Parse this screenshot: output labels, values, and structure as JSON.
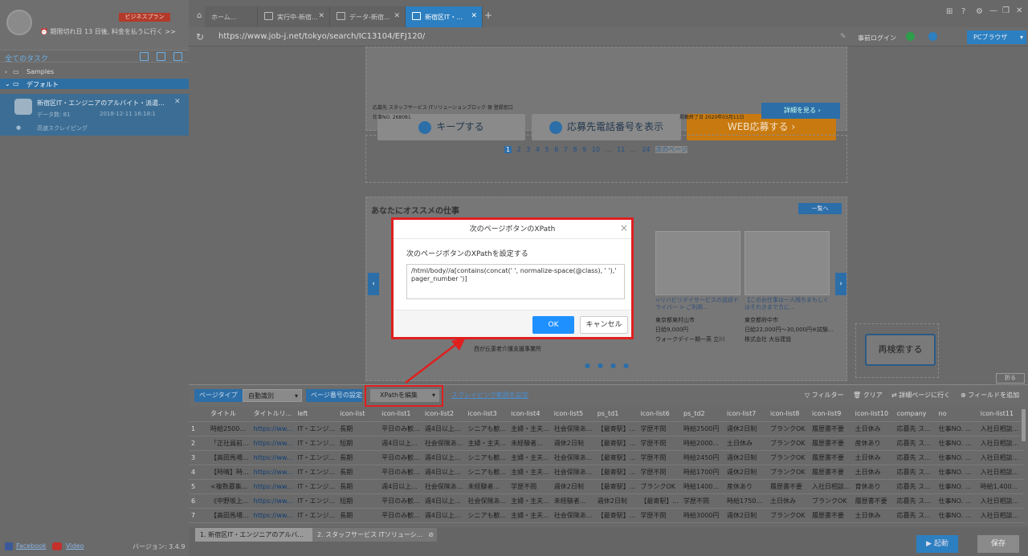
{
  "sidebar": {
    "plan_badge": "ビジネスプラン",
    "expiry": "期限切れ日 13 日後, 料金を払うに行く >>",
    "tasks_header": "全てのタスク",
    "samples": "Samples",
    "default_folder": "デフォルト",
    "task_name": "新宿区IT・エンジニアのアルバイト・派遣...",
    "task_data": "データ数: 81",
    "task_date": "2018-12-11 16:18:1",
    "task_mode": "高速スクレイピング",
    "facebook": "Facebook",
    "video": "Video",
    "version": "バージョン: 3.4.9"
  },
  "tabs": [
    {
      "label": "ホーム...",
      "close": ""
    },
    {
      "label": "実行中-新宿...",
      "close": "✕"
    },
    {
      "label": "データ-新宿...",
      "close": "✕"
    },
    {
      "label": "新宿区IT・...",
      "close": "✕"
    }
  ],
  "address": {
    "url": "https://www.job-j.net/tokyo/search/IC13104/EFJ120/",
    "login": "事前ログイン",
    "browser": "PCブラウザ"
  },
  "page": {
    "keep": "キープする",
    "phone": "応募先電話番号を表示",
    "apply": "WEB応募する",
    "detail": "詳細を見る",
    "applicant": "応募先 スタッフサービス ITソリューションブロック 保 登録窓口",
    "jobno": "仕事NO. 268081",
    "posted": "掲載終了日 2020年03月11日",
    "pages": [
      "1",
      "2",
      "3",
      "4",
      "5",
      "6",
      "7",
      "8",
      "9",
      "10",
      "…",
      "11",
      "…",
      "24",
      "次のページ"
    ],
    "recommend_title": "あなたにオススメの仕事",
    "recommend_more": "一覧へ",
    "rec1_title": "<リハビリデイサービスの送迎ドライバー > ご利用...",
    "rec1_place": "東京都東村山市",
    "rec1_pay": "日給9,000円",
    "rec1_company": "ウォークデイー期一英 立川",
    "rec2_title": "【このお仕事は一人残ちまもしくはそれきまで方に...",
    "rec2_place": "東京都府中市",
    "rec2_pay": "日給22,000円～30,000円※試験...",
    "rec2_company": "株式会社 大谷建設",
    "bottom_company": "西が丘恵老介護支援事業所",
    "research": "再検索する"
  },
  "toolbar": {
    "page_type": "ページタイプ",
    "page_type_value": "自動識別",
    "page_number": "ページ番号の設定",
    "xpath": "XPathを編集",
    "scroll": "スクレイピング範囲を設定",
    "filter": "フィルター",
    "clear": "クリア",
    "detail_page": "詳細ページに行く",
    "add_field": "フィールドを追加",
    "collapse": "折る"
  },
  "table": {
    "columns": [
      "",
      "タイトル",
      "タイトルリ...",
      "left",
      "icon-list",
      "icon-list1",
      "icon-list2",
      "icon-list3",
      "icon-list4",
      "icon-list5",
      "ps_td1",
      "icon-list6",
      "ps_td2",
      "icon-list7",
      "icon-list8",
      "icon-list9",
      "icon-list10",
      "company",
      "no",
      "icon-list11"
    ],
    "rows": [
      [
        "1",
        "時給2500...",
        "https://ww...",
        "IT・エンジ...",
        "長期",
        "平日のみ歓...",
        "週4日以上...",
        "シニアも歓...",
        "主婦・主夫...",
        "社会保険あ...",
        "【最寄駅】...",
        "学歴不問",
        "時給2500円",
        "週休2日制",
        "ブランクOK",
        "履歴書不要",
        "土日休み",
        "応募先 ス...",
        "仕事NO. ...",
        "入社日相談..."
      ],
      [
        "2",
        "「正社員前...",
        "https://ww...",
        "IT・エンジ...",
        "短期",
        "週4日以上...",
        "社会保険あ...",
        "主婦・主夫...",
        "未経験者...",
        "週休2日制",
        "【最寄駅】...",
        "学歴不問",
        "時給2000...",
        "土日休み",
        "ブランクOK",
        "履歴書不要",
        "産休あり",
        "応募先 ス...",
        "仕事NO. ...",
        "入社日相談..."
      ],
      [
        "3",
        "【高田馬場...",
        "https://ww...",
        "IT・エンジ...",
        "長期",
        "平日のみ歓...",
        "週4日以上...",
        "シニアも歓...",
        "主婦・主夫...",
        "社会保険あ...",
        "【最寄駅】...",
        "学歴不問",
        "時給2450円",
        "週休2日制",
        "ブランクOK",
        "履歴書不要",
        "土日休み",
        "応募先 ス...",
        "仕事NO. ...",
        "入社日相談..."
      ],
      [
        "4",
        "【時晴】時...",
        "https://ww...",
        "IT・エンジ...",
        "長期",
        "平日のみ歓...",
        "週4日以上...",
        "シニアも歓...",
        "主婦・主夫...",
        "社会保険あ...",
        "【最寄駅】...",
        "学歴不問",
        "時給1700円",
        "週休2日制",
        "ブランクOK",
        "履歴書不要",
        "土日休み",
        "応募先 ス...",
        "仕事NO. ...",
        "入社日相談..."
      ],
      [
        "5",
        "<複数募集...",
        "https://ww...",
        "IT・エンジ...",
        "長期",
        "週4日以上...",
        "社会保険あ...",
        "未経験者...",
        "学歴不問",
        "週休2日制",
        "【最寄駅】...",
        "ブランクOK",
        "時給1400...",
        "産休あり",
        "履歴書不要",
        "入社日相談...",
        "育休あり",
        "応募先 ス...",
        "仕事NO. ...",
        "時給1,400..."
      ],
      [
        "6",
        "《中野坂上...",
        "https://ww...",
        "IT・エンジ...",
        "短期",
        "平日のみ歓...",
        "週4日以上...",
        "社会保険あ...",
        "主婦・主夫...",
        "未経験者...",
        "週休2日制",
        "【最寄駅】...",
        "学歴不問",
        "時給1750...",
        "土日休み",
        "ブランクOK",
        "履歴書不要",
        "応募先 ス...",
        "仕事NO. ...",
        "入社日相談..."
      ],
      [
        "7",
        "【高田馬場...",
        "https://ww...",
        "IT・エンジ...",
        "長期",
        "平日のみ歓...",
        "週4日以上...",
        "シニアも歓...",
        "主婦・主夫...",
        "社会保険あ...",
        "【最寄駅】...",
        "学歴不問",
        "時給3000円",
        "週休2日制",
        "ブランクOK",
        "履歴書不要",
        "土日休み",
        "応募先 ス...",
        "仕事NO. ...",
        "入社日相談..."
      ]
    ]
  },
  "bottom": {
    "tab1": "1. 新宿区IT・エンジニアのアルバ...",
    "tab2": "2. スタッフサービス  ITソリューシ...",
    "run": "起動",
    "save": "保存"
  },
  "dialog": {
    "title": "次のページボタンのXPath",
    "label": "次のページボタンのXPathを設定する",
    "xpath_value": "/html/body//a[contains(concat(' ', normalize-space(@class), ' '),' pager_number ')]",
    "ok": "OK",
    "cancel": "キャンセル"
  },
  "colors": {
    "accent": "#2c7fc0",
    "highlight": "#e01f1f",
    "apply_orange": "#c87a10"
  }
}
